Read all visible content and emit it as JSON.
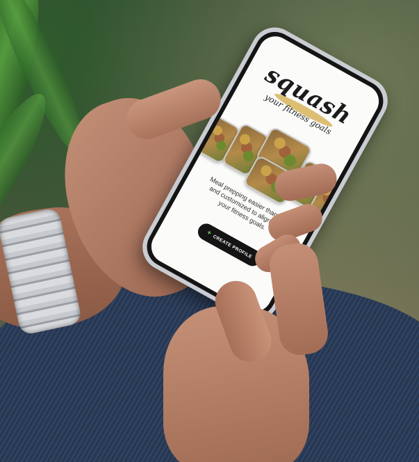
{
  "app": {
    "logo_text": "squash",
    "tagline": "your fitness goals",
    "description": "Meal prepping easier than ever and customized to align with your fitness goals.",
    "cta_label": "CREATE PROFILE",
    "cta_icon": "plus-icon"
  },
  "colors": {
    "accent_swoosh": "#d6b45a",
    "button_bg": "#141414",
    "plus_icon": "#7fc96b"
  }
}
